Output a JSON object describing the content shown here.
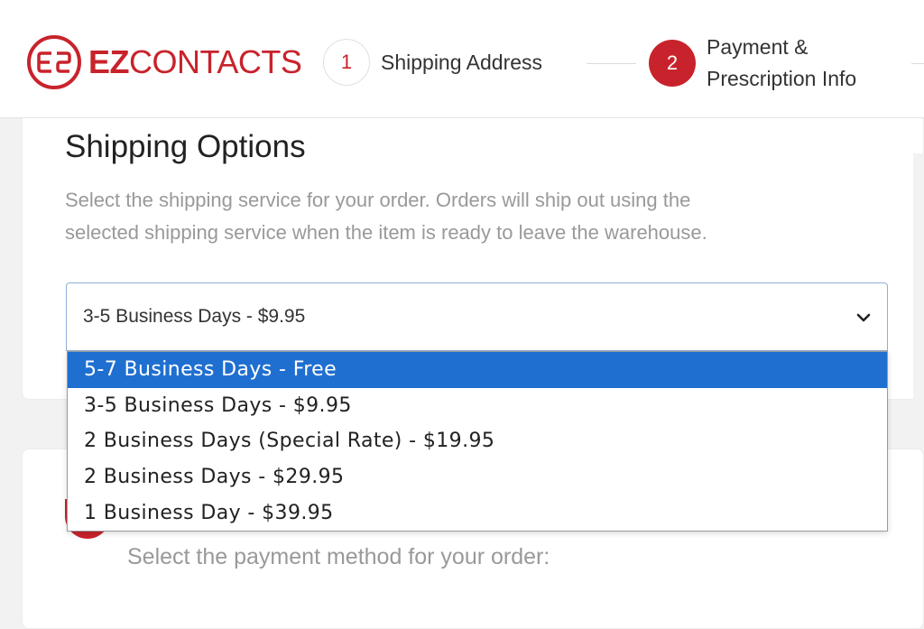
{
  "brand": {
    "name_bold": "EZ",
    "name_thin": "CONTACTS",
    "color": "#c8232c"
  },
  "steps": [
    {
      "number": "1",
      "label": "Shipping Address",
      "state": "inactive"
    },
    {
      "number": "2",
      "label_line1": "Payment &",
      "label_line2": "Prescription Info",
      "state": "active"
    }
  ],
  "shipping": {
    "title": "Shipping Options",
    "description_line1": "Select the shipping service for your order. Orders will ship out using the",
    "description_line2": "selected shipping service when the item is ready to leave the warehouse.",
    "selected_value": "3-5 Business Days - $9.95",
    "options": [
      {
        "label": "5-7 Business Days - Free",
        "highlighted": true
      },
      {
        "label": "3-5 Business Days - $9.95",
        "highlighted": false
      },
      {
        "label": "2 Business Days (Special Rate) - $19.95",
        "highlighted": false
      },
      {
        "label": "2 Business Days - $29.95",
        "highlighted": false
      },
      {
        "label": "1 Business Day - $39.95",
        "highlighted": false
      }
    ]
  },
  "payment": {
    "description": "Select the payment method for your order:"
  },
  "colors": {
    "accent": "#c8232c",
    "highlight": "#1f6fd0",
    "muted_text": "#999999"
  },
  "icons": {
    "logo": "ezcontacts-logo-icon",
    "chevron": "chevron-down-icon"
  }
}
